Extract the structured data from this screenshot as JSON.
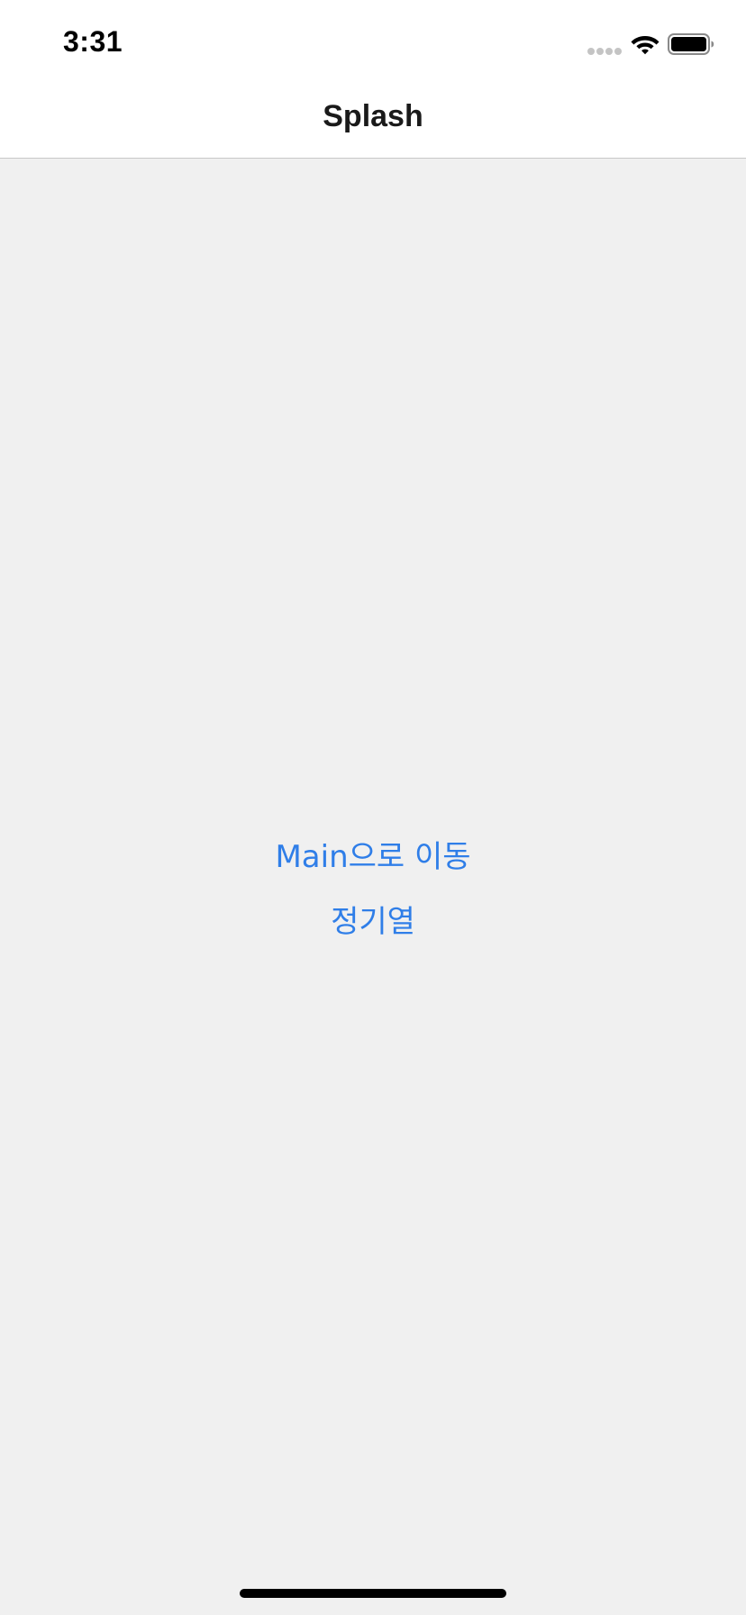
{
  "status_bar": {
    "time": "3:31",
    "icons": [
      "signal-dots-icon",
      "wifi-icon",
      "battery-icon"
    ]
  },
  "nav_bar": {
    "title": "Splash"
  },
  "main": {
    "buttons": [
      {
        "label": "Main으로 이동"
      },
      {
        "label": "정기열"
      }
    ]
  },
  "colors": {
    "accent": "#2f7ee8",
    "background": "#f0f0f0",
    "bar_background": "#ffffff",
    "divider": "#c8c8c8"
  }
}
